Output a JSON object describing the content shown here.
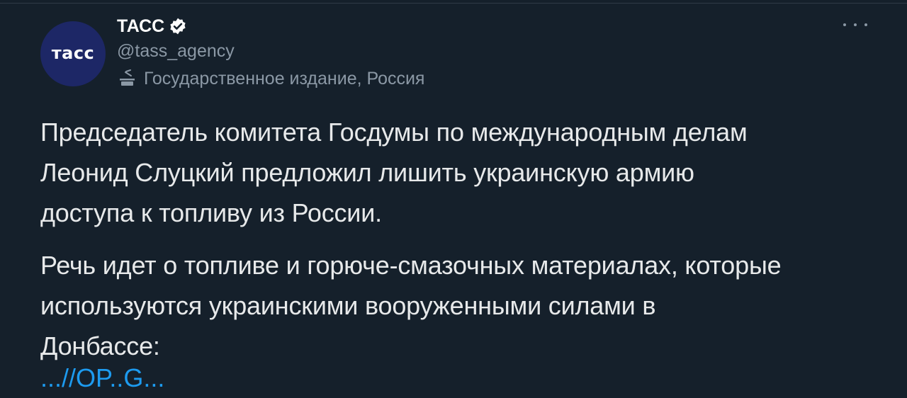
{
  "account": {
    "avatar_text": "тасс",
    "display_name": "ТАСС",
    "handle": "@tass_agency",
    "affiliation": "Государственное издание, Россия",
    "verified": true
  },
  "icons": {
    "verified": "verified-badge-icon",
    "affiliation": "state-media-icon",
    "more": "more-options-icon"
  },
  "tweet": {
    "lines_p1": [
      "Председатель комитета Госдумы по международным делам",
      "Леонид Слуцкий предложил лишить украинскую армию",
      "доступа к топливу из России."
    ],
    "lines_p2": [
      "Речь идет о топливе и горюче-смазочных материалах, которые",
      "используются украинскими вооруженными силами в",
      "Донбассе:"
    ],
    "link_partial": "...//OP..G..."
  },
  "colors": {
    "background": "#15202b",
    "text": "#e7e9ea",
    "muted": "#8b98a5",
    "link": "#1d9bf0",
    "avatar_bg": "#1d2766"
  }
}
